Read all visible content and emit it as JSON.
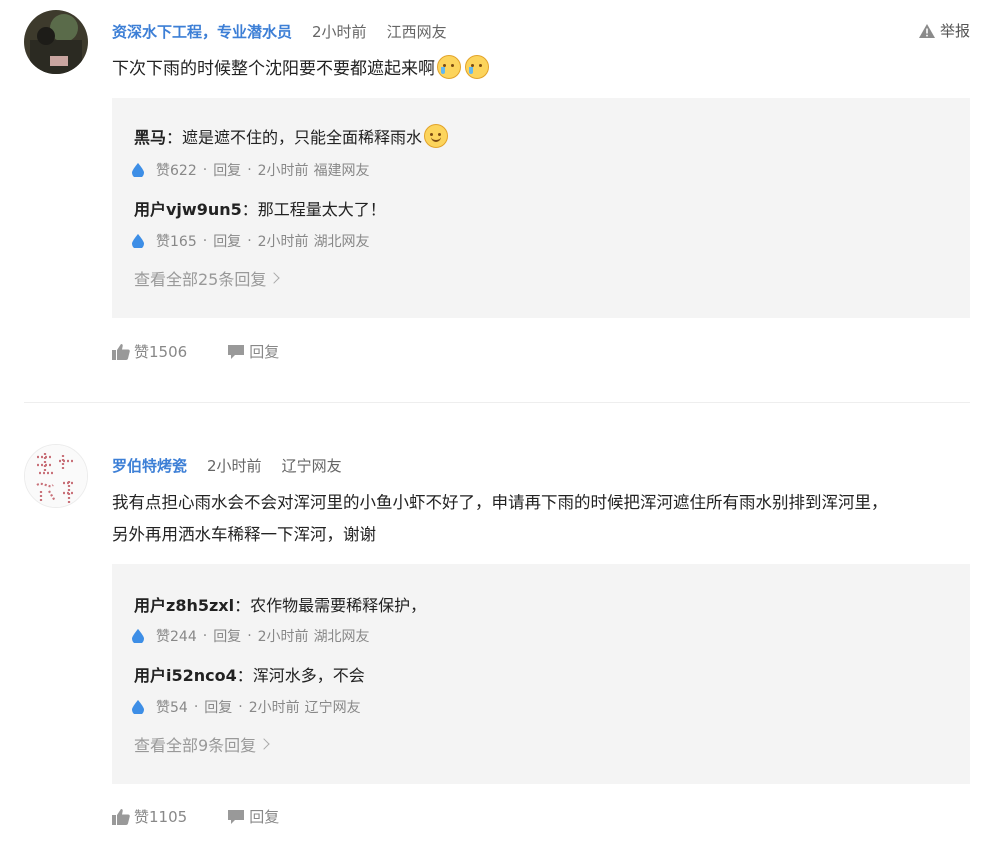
{
  "comments": [
    {
      "author": "资深水下工程，专业潜水员",
      "time": "2小时前",
      "location": "江西网友",
      "report_label": "举报",
      "text": "下次下雨的时候整个沈阳要不要都遮起来啊",
      "emoji": [
        "crying-face-icon",
        "crying-face-icon"
      ],
      "replies": [
        {
          "name": "黑马",
          "text": "遮是遮不住的，只能全面稀释雨水",
          "emoji": "smiling-face-icon",
          "likes": "赞622",
          "reply_label": "回复",
          "time": "2小时前",
          "location": "福建网友"
        },
        {
          "name": "用户vjw9un5",
          "text": "那工程量太大了！",
          "likes": "赞165",
          "reply_label": "回复",
          "time": "2小时前",
          "location": "湖北网友"
        }
      ],
      "view_all": "查看全部25条回复",
      "likes": "赞1506",
      "reply_label": "回复"
    },
    {
      "author": "罗伯特烤瓷",
      "time": "2小时前",
      "location": "辽宁网友",
      "text_line1": "我有点担心雨水会不会对浑河里的小鱼小虾不好了，申请再下雨的时候把浑河遮住所有雨水别排到浑河里，",
      "text_line2": "另外再用洒水车稀释一下浑河，谢谢",
      "replies": [
        {
          "name": "用户z8h5zxl",
          "text": "农作物最需要稀释保护，",
          "likes": "赞244",
          "reply_label": "回复",
          "time": "2小时前",
          "location": "湖北网友"
        },
        {
          "name": "用户i52nco4",
          "text": "浑河水多，不会",
          "likes": "赞54",
          "reply_label": "回复",
          "time": "2小时前",
          "location": "辽宁网友"
        }
      ],
      "view_all": "查看全部9条回复",
      "likes": "赞1105",
      "reply_label": "回复"
    }
  ],
  "separator": "：",
  "meta_dot": "·",
  "colors": {
    "author": "#3d7fd6",
    "reply_bg": "#f4f4f4",
    "drop": "#3d8ee6"
  }
}
